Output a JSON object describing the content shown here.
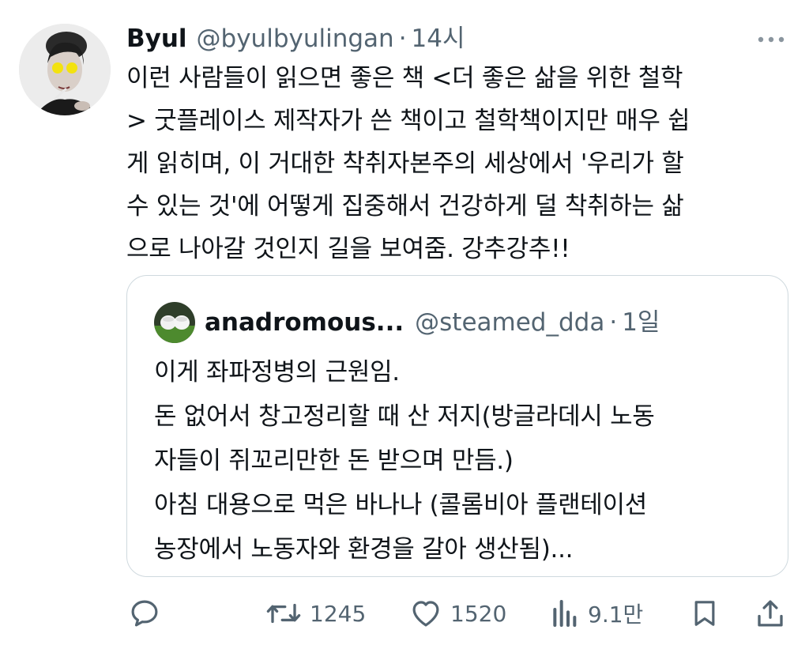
{
  "tweet": {
    "author_name": "Byul",
    "handle": "@byulbyulingan",
    "separator": "·",
    "time": "14시",
    "more_icon": "more-horizontal-icon",
    "text": "이런 사람들이 읽으면 좋은 책 <더 좋은 삶을 위한 철학\n> 굿플레이스 제작자가 쓴 책이고 철학책이지만 매우 쉽\n게 읽히며, 이 거대한 착취자본주의 세상에서 '우리가 할\n수 있는 것'에 어떻게 집중해서 건강하게 덜 착취하는 삶\n으로 나아갈 것인지 길을 보여줌. 강추강추!!"
  },
  "quote": {
    "author_name": "anadromous...",
    "handle": "@steamed_dda",
    "separator": "·",
    "time": "1일",
    "text": "이게 좌파정병의 근원임.\n돈 없어서 창고정리할 때 산 저지(방글라데시 노동\n자들이 쥐꼬리만한 돈 받으며 만듬.)\n아침 대용으로 먹은 바나나 (콜롬비아 플랜테이션\n농장에서 노동자와 환경을 갈아 생산됨)..."
  },
  "actions": {
    "reply_icon": "reply-icon",
    "retweet_icon": "retweet-icon",
    "retweet_count": "1245",
    "like_icon": "heart-icon",
    "like_count": "1520",
    "views_icon": "views-icon",
    "views_count": "9.1만",
    "bookmark_icon": "bookmark-icon",
    "share_icon": "share-icon"
  },
  "colors": {
    "text": "#0f1419",
    "secondary": "#536471",
    "border": "#cfd9de"
  }
}
